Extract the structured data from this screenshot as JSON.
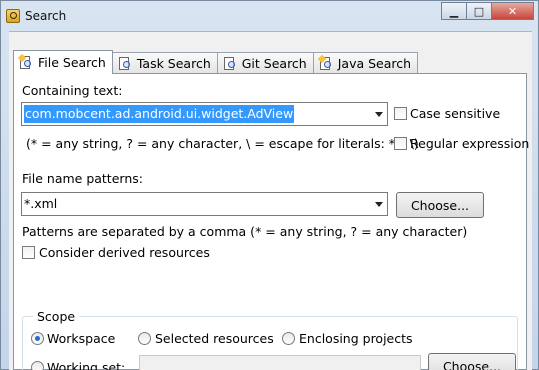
{
  "window": {
    "title": "Search",
    "minimize": "▁",
    "maximize": "□",
    "close": "✕"
  },
  "tabs": [
    {
      "label": "File Search",
      "icon": "file-search-icon",
      "active": true
    },
    {
      "label": "Task Search",
      "icon": "task-search-icon",
      "active": false
    },
    {
      "label": "Git Search",
      "icon": "git-search-icon",
      "active": false
    },
    {
      "label": "Java Search",
      "icon": "java-search-icon",
      "active": false
    }
  ],
  "containing": {
    "label": "Containing text:",
    "value": "com.mobcent.ad.android.ui.widget.AdView",
    "hint": "(* = any string, ? = any character, \\ = escape for literals: * ? \\)",
    "case_sensitive": "Case sensitive",
    "regex": "Regular expression"
  },
  "patterns": {
    "label": "File name patterns:",
    "value": "*.xml",
    "choose": "Choose...",
    "hint": "Patterns are separated by a comma (* = any string, ? = any character)",
    "derived": "Consider derived resources"
  },
  "scope": {
    "title": "Scope",
    "workspace": "Workspace",
    "selected": "Selected resources",
    "enclosing": "Enclosing projects",
    "working_set": "Working set:",
    "choose": "Choose..."
  },
  "colors": {
    "selection": "#3399ff",
    "radio_dot": "#2a6bd1"
  }
}
